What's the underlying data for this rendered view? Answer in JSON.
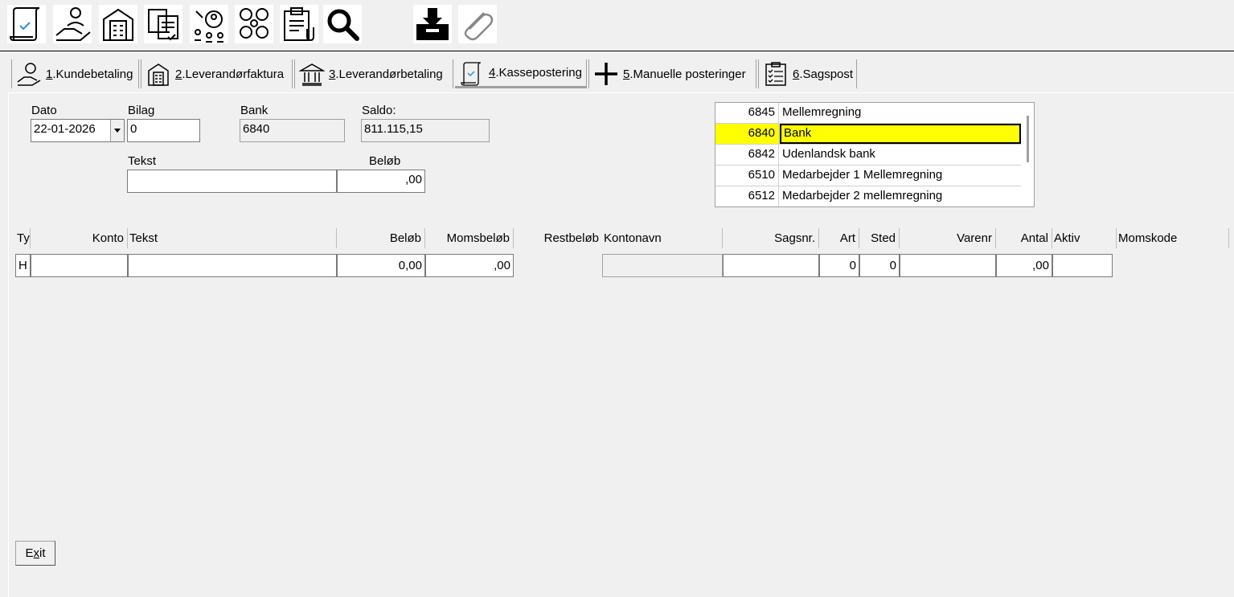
{
  "toolbar": {
    "icons": [
      "receipt-check-icon",
      "hand-person-icon",
      "buildings-icon",
      "documents-check-icon",
      "users-network-icon",
      "apps-grid-icon",
      "clipboard-attach-icon",
      "search-icon",
      "download-tray-icon",
      "paperclip-icon"
    ]
  },
  "tabs": [
    {
      "key": "1",
      "label": ".Kundebetaling",
      "icon": "hand-coin-icon"
    },
    {
      "key": "2",
      "label": ".Leverandørfaktura",
      "icon": "office-building-icon"
    },
    {
      "key": "3",
      "label": ".Leverandørbetaling",
      "icon": "bank-icon"
    },
    {
      "key": "4",
      "label": ".Kassepostering",
      "icon": "receipt-icon",
      "active": true
    },
    {
      "key": "5",
      "label": ".Manuelle posteringer",
      "icon": "plus-icon"
    },
    {
      "key": "6",
      "label": ".Sagspost",
      "icon": "checklist-icon"
    }
  ],
  "form": {
    "dato_label": "Dato",
    "dato_value": "22-01-2026",
    "bilag_label": "Bilag",
    "bilag_value": "0",
    "bank_label": "Bank",
    "bank_value": "6840",
    "saldo_label": "Saldo:",
    "saldo_value": "811.115,15",
    "tekst_label": "Tekst",
    "tekst_value": "",
    "belob_label": "Beløb",
    "belob_value": ",00"
  },
  "lookup": {
    "rows": [
      {
        "code": "6845",
        "name": "Mellemregning"
      },
      {
        "code": "6840",
        "name": "Bank",
        "selected": true
      },
      {
        "code": "6842",
        "name": "Udenlandsk bank"
      },
      {
        "code": "6510",
        "name": "Medarbejder 1 Mellemregning"
      },
      {
        "code": "6512",
        "name": "Medarbejder 2 mellemregning"
      }
    ]
  },
  "grid": {
    "headers": {
      "ty": "Ty",
      "konto": "Konto",
      "tekst": "Tekst",
      "belob": "Beløb",
      "momsbelob": "Momsbeløb",
      "restbelob": "Restbeløb",
      "kontonavn": "Kontonavn",
      "sagsnr": "Sagsnr.",
      "art": "Art",
      "sted": "Sted",
      "varenr": "Varenr",
      "antal": "Antal",
      "aktiv": "Aktiv",
      "momskode": "Momskode"
    },
    "row": {
      "ty": "H",
      "konto": "",
      "tekst": "",
      "belob": "0,00",
      "momsbelob": ",00",
      "kontonavn": "",
      "sagsnr": "",
      "art": "0",
      "sted": "0",
      "varenr": "",
      "antal": ",00",
      "aktiv": ""
    }
  },
  "buttons": {
    "exit_prefix": "E",
    "exit_underlined": "x",
    "exit_suffix": "it"
  }
}
